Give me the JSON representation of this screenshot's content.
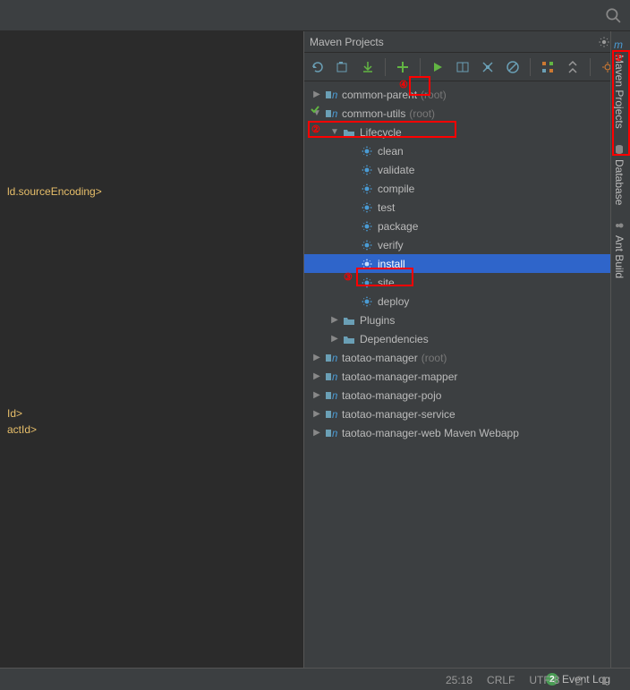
{
  "panel": {
    "title": "Maven Projects"
  },
  "editor": {
    "line1": "ld.sourceEncoding>",
    "line2": "",
    "line3": "Id>",
    "line4": "actId>"
  },
  "tree": {
    "items": [
      {
        "indent": 0,
        "expand": "▶",
        "icon": "maven",
        "label": "common-parent",
        "suffix": "(root)"
      },
      {
        "indent": 0,
        "expand": "▼",
        "icon": "maven",
        "label": "common-utils",
        "suffix": "(root)"
      },
      {
        "indent": 1,
        "expand": "▼",
        "icon": "folder",
        "label": "Lifecycle",
        "suffix": ""
      },
      {
        "indent": 2,
        "expand": "",
        "icon": "gear",
        "label": "clean",
        "suffix": ""
      },
      {
        "indent": 2,
        "expand": "",
        "icon": "gear",
        "label": "validate",
        "suffix": ""
      },
      {
        "indent": 2,
        "expand": "",
        "icon": "gear",
        "label": "compile",
        "suffix": ""
      },
      {
        "indent": 2,
        "expand": "",
        "icon": "gear",
        "label": "test",
        "suffix": ""
      },
      {
        "indent": 2,
        "expand": "",
        "icon": "gear",
        "label": "package",
        "suffix": ""
      },
      {
        "indent": 2,
        "expand": "",
        "icon": "gear",
        "label": "verify",
        "suffix": ""
      },
      {
        "indent": 2,
        "expand": "",
        "icon": "gear",
        "label": "install",
        "suffix": "",
        "selected": true
      },
      {
        "indent": 2,
        "expand": "",
        "icon": "gear",
        "label": "site",
        "suffix": ""
      },
      {
        "indent": 2,
        "expand": "",
        "icon": "gear",
        "label": "deploy",
        "suffix": ""
      },
      {
        "indent": 1,
        "expand": "▶",
        "icon": "folder",
        "label": "Plugins",
        "suffix": ""
      },
      {
        "indent": 1,
        "expand": "▶",
        "icon": "folder",
        "label": "Dependencies",
        "suffix": ""
      },
      {
        "indent": 0,
        "expand": "▶",
        "icon": "maven",
        "label": "taotao-manager",
        "suffix": "(root)"
      },
      {
        "indent": 0,
        "expand": "▶",
        "icon": "maven",
        "label": "taotao-manager-mapper",
        "suffix": ""
      },
      {
        "indent": 0,
        "expand": "▶",
        "icon": "maven",
        "label": "taotao-manager-pojo",
        "suffix": ""
      },
      {
        "indent": 0,
        "expand": "▶",
        "icon": "maven",
        "label": "taotao-manager-service",
        "suffix": ""
      },
      {
        "indent": 0,
        "expand": "▶",
        "icon": "maven",
        "label": "taotao-manager-web Maven Webapp",
        "suffix": ""
      }
    ]
  },
  "sidetabs": {
    "maven": "Maven Projects",
    "database": "Database",
    "ant": "Ant Build"
  },
  "status": {
    "pos": "25:18",
    "lineend": "CRLF",
    "encoding": "UTF-8",
    "eventlog": "Event Log",
    "badge": "2"
  },
  "annotations": {
    "n1": "①",
    "n2": "②",
    "n3": "③",
    "n4": "④"
  }
}
